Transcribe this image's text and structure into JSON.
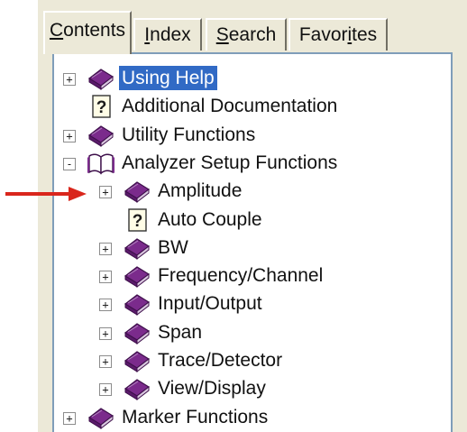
{
  "tabs": [
    {
      "pre": "",
      "u": "C",
      "post": "ontents"
    },
    {
      "pre": "",
      "u": "I",
      "post": "ndex"
    },
    {
      "pre": "",
      "u": "S",
      "post": "earch"
    },
    {
      "pre": "Favor",
      "u": "i",
      "post": "tes"
    }
  ],
  "tree": [
    {
      "label": "Using Help",
      "icon": "book-icon",
      "expander": "+",
      "selected": true
    },
    {
      "label": "Additional Documentation",
      "icon": "help-page-icon"
    },
    {
      "label": "Utility Functions",
      "icon": "book-icon",
      "expander": "+"
    },
    {
      "label": "Analyzer Setup Functions",
      "icon": "open-book-icon",
      "expander": "-"
    },
    {
      "label": "Amplitude",
      "icon": "book-icon",
      "expander": "+"
    },
    {
      "label": "Auto Couple",
      "icon": "help-page-icon"
    },
    {
      "label": "BW",
      "icon": "book-icon",
      "expander": "+"
    },
    {
      "label": "Frequency/Channel",
      "icon": "book-icon",
      "expander": "+"
    },
    {
      "label": "Input/Output",
      "icon": "book-icon",
      "expander": "+"
    },
    {
      "label": "Span",
      "icon": "book-icon",
      "expander": "+"
    },
    {
      "label": "Trace/Detector",
      "icon": "book-icon",
      "expander": "+"
    },
    {
      "label": "View/Display",
      "icon": "book-icon",
      "expander": "+"
    },
    {
      "label": "Marker Functions",
      "icon": "book-icon",
      "expander": "+"
    }
  ],
  "colors": {
    "arrow": "#d9261c",
    "book": "#7b2b8c",
    "selection": "#316ac5"
  }
}
